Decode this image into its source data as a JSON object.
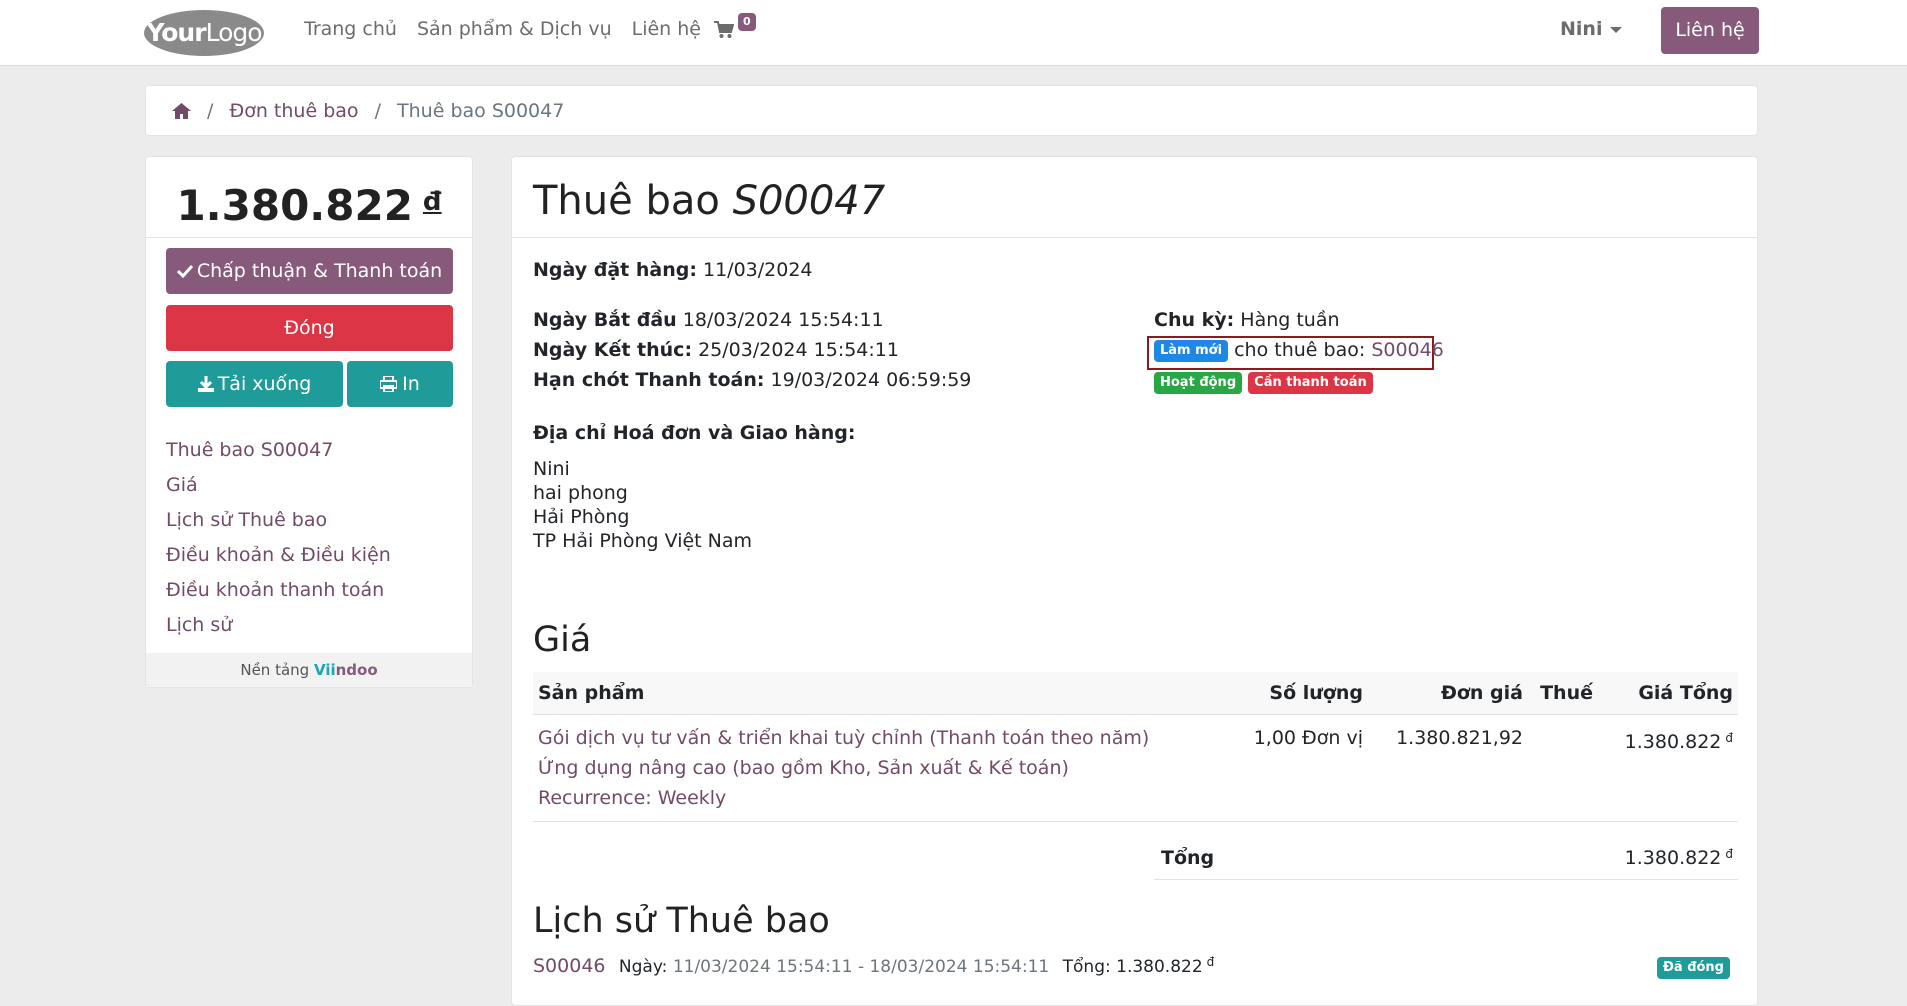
{
  "header": {
    "logo_your": "Your",
    "logo_logo": "Logo",
    "nav": [
      "Trang chủ",
      "Sản phẩm & Dịch vụ",
      "Liên hệ"
    ],
    "cart_count": "0",
    "user": "Nini",
    "contact_button": "Liên hệ"
  },
  "breadcrumb": {
    "items": [
      "Đơn thuê bao",
      "Thuê bao S00047"
    ],
    "sep": "/"
  },
  "sidebar": {
    "amount": "1.380.822",
    "currency": "đ",
    "accept_button": "Chấp thuận & Thanh toán",
    "close_button": "Đóng",
    "download_button": "Tải xuống",
    "print_button": "In",
    "links": [
      "Thuê bao S00047",
      "Giá",
      "Lịch sử Thuê bao",
      "Điều khoản & Điều kiện",
      "Điều khoản thanh toán",
      "Lịch sử"
    ],
    "powered_prefix": "Nền tảng",
    "powered_v1": "Vii",
    "powered_v2": "ndoo"
  },
  "main": {
    "title_prefix": "Thuê bao",
    "title_ref": "S00047",
    "order_date_label": "Ngày đặt hàng:",
    "order_date": "11/03/2024",
    "start_label": "Ngày Bắt đầu",
    "start_value": "18/03/2024 15:54:11",
    "end_label": "Ngày Kết thúc:",
    "end_value": "25/03/2024 15:54:11",
    "due_label": "Hạn chót Thanh toán:",
    "due_value": "19/03/2024 06:59:59",
    "cycle_label": "Chu kỳ:",
    "cycle_value": "Hàng tuần",
    "renew_badge": "Làm mới",
    "renew_text": "cho thuê bao:",
    "renew_ref": "S00046",
    "status_active": "Hoạt động",
    "status_payment": "Cần thanh toán",
    "address_label": "Địa chỉ Hoá đơn và Giao hàng:",
    "address_lines": [
      "Nini",
      "hai phong",
      "Hải Phòng",
      "TP Hải Phòng Việt Nam"
    ]
  },
  "prices": {
    "heading": "Giá",
    "columns": [
      "Sản phẩm",
      "Số lượng",
      "Đơn giá",
      "Thuế",
      "Giá Tổng"
    ],
    "row": {
      "desc": [
        "Gói dịch vụ tư vấn & triển khai tuỳ chỉnh (Thanh toán theo năm)",
        "Ứng dụng nâng cao (bao gồm Kho, Sản xuất & Kế toán)",
        "Recurrence: Weekly"
      ],
      "qty": "1,00 Đơn vị",
      "unit_price": "1.380.821,92",
      "tax": "",
      "total": "1.380.822",
      "currency": "đ"
    },
    "total_label": "Tổng",
    "total_value": "1.380.822",
    "total_currency": "đ"
  },
  "history": {
    "heading": "Lịch sử Thuê bao",
    "ref": "S00046",
    "date_label": "Ngày:",
    "date_range": "11/03/2024 15:54:11 - 18/03/2024 15:54:11",
    "total_label": "Tổng:",
    "total_value": "1.380.822",
    "currency": "đ",
    "status": "Đã đóng"
  }
}
